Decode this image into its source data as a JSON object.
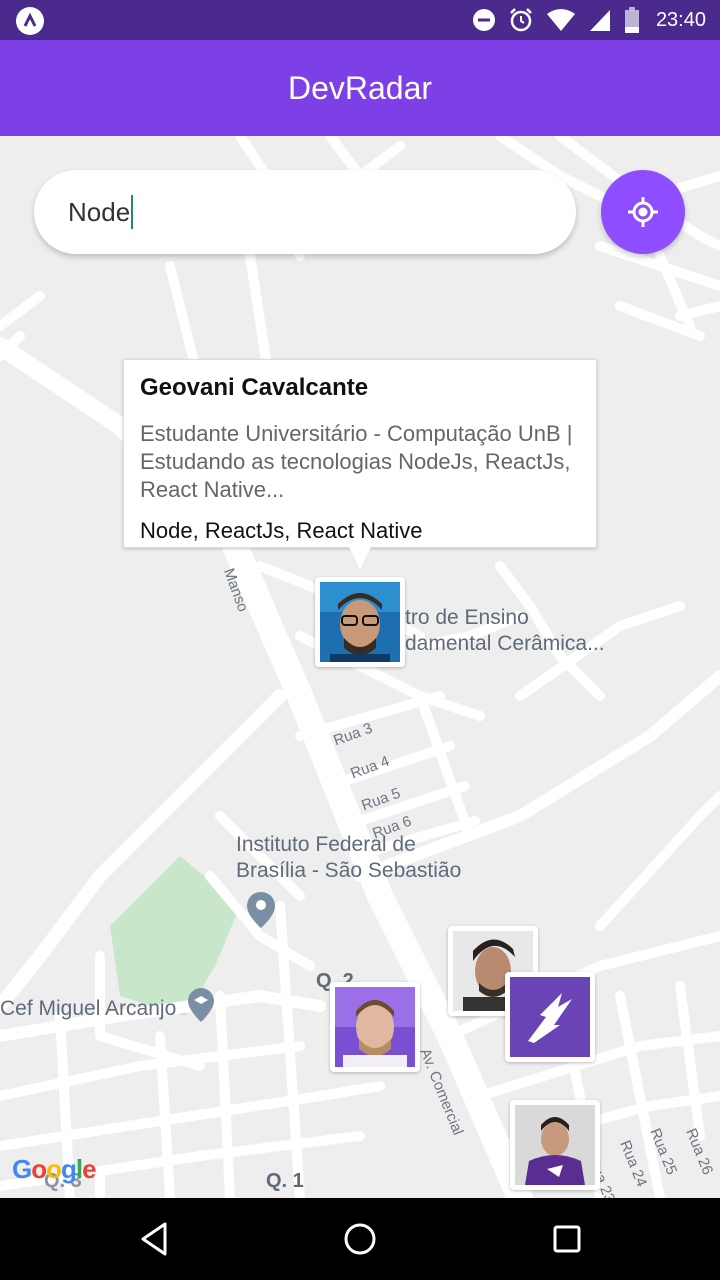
{
  "status_bar": {
    "time": "23:40",
    "icons": [
      "app-logo-icon",
      "do-not-disturb-icon",
      "alarm-icon",
      "wifi-icon",
      "signal-icon",
      "battery-icon"
    ]
  },
  "app_bar": {
    "title": "DevRadar"
  },
  "search": {
    "value": "Node",
    "placeholder": ""
  },
  "locate_button": {
    "icon": "my-location-icon"
  },
  "callout": {
    "name": "Geovani Cavalcante",
    "bio": "Estudante Universitário - Computação UnB | Estudando as tecnologias NodeJs, ReactJs, React Native...",
    "techs": "Node, ReactJs, React Native"
  },
  "map": {
    "places": [
      "tro de Ensino",
      "damental Cerâmica...",
      "Instituto Federal de",
      "Brasília - São Sebastião",
      "Cef Miguel Arcanjo"
    ],
    "streets": [
      "Manso",
      "Rua 3",
      "Rua 4",
      "Rua 5",
      "Rua 6",
      "Av. Comercial",
      "Rua 23",
      "Rua 24",
      "Rua 25",
      "Rua 26"
    ],
    "blocks": [
      "Q. 2",
      "Q. 1",
      "Q. 3"
    ],
    "attribution": "Google"
  },
  "colors": {
    "status_bar": "#4a2a8c",
    "app_bar": "#7d40e7",
    "accent": "#8e4dff",
    "map_bg": "#eeeeee",
    "park": "#c8e6c9"
  },
  "nav": {
    "icons": [
      "back-icon",
      "home-icon",
      "recents-icon"
    ]
  }
}
